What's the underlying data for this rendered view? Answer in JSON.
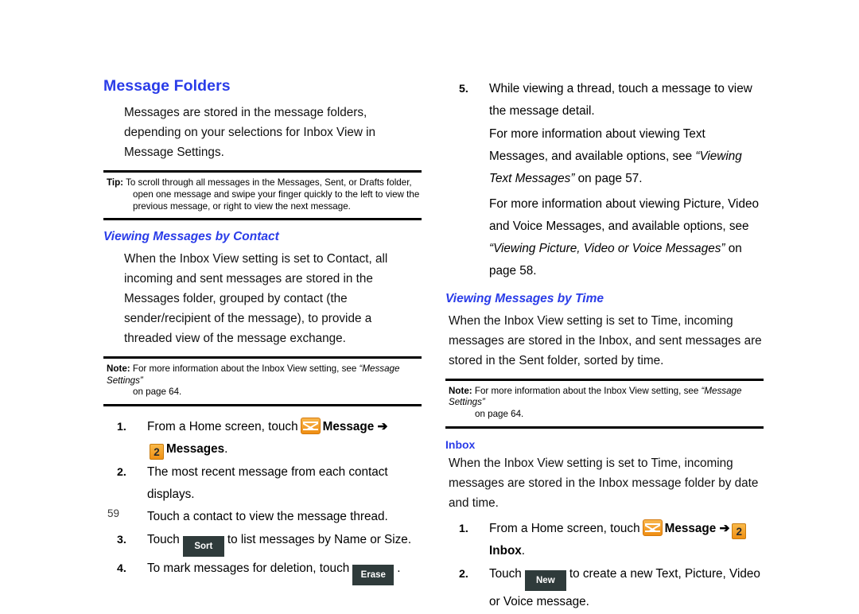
{
  "page": {
    "number": "59"
  },
  "left_column": {
    "heading": "Message Folders",
    "intro": "Messages are stored in the message folders, depending on your selections for Inbox View in Message Settings.",
    "tip": {
      "label": "Tip:",
      "line1": "To scroll through all messages in the Messages, Sent, or Drafts folder,",
      "line2": "open one message and swipe your finger quickly to the left to view the previous message, or right to view the next message."
    },
    "subheading": "Viewing Messages by Contact",
    "body": "When the Inbox View setting is set to Contact, all incoming and sent messages are stored in the Messages folder, grouped by contact (the sender/recipient of the message), to provide a threaded view of the message exchange.",
    "note": {
      "label": "Note:",
      "line1": "For more information about the Inbox View setting, see",
      "ref": "“Message Settings”",
      "line2": "on page 64."
    },
    "steps": [
      {
        "num": "1.",
        "text_before": "From a Home screen, touch",
        "icon": "envelope-icon",
        "link_label": "Message",
        "arrow": "➔",
        "badge": "2",
        "target_label": "Messages",
        "period": "."
      },
      {
        "num": "2.",
        "line1": "The most recent message from each contact displays.",
        "line2": "Touch a contact to view the message thread."
      },
      {
        "num": "3.",
        "text_before": "Touch",
        "button": "Sort",
        "text_after": "to list messages by Name or Size."
      },
      {
        "num": "4.",
        "text_before": "To mark messages for deletion, touch",
        "button": "Erase",
        "text_after": "."
      }
    ]
  },
  "right_column": {
    "step5": {
      "num": "5.",
      "line1": "While viewing a thread, touch a message to view the message detail.",
      "para1_a": "For more information about viewing Text Messages, and available options, see",
      "para1_ref": "“Viewing Text Messages”",
      "para1_b": "on page 57.",
      "para2_a": "For more information about viewing Picture, Video and Voice Messages, and available options, see",
      "para2_ref": "“Viewing Picture, Video or Voice Messages”",
      "para2_b": "on page 58."
    },
    "subheading": "Viewing Messages by Time",
    "body": "When the Inbox View setting is set to Time, incoming messages are stored in the Inbox, and sent messages are stored in the Sent folder, sorted by time.",
    "note": {
      "label": "Note:",
      "line1": "For more information about the Inbox View setting, see",
      "ref": "“Message Settings”",
      "line2": "on page 64."
    },
    "inbox_heading": "Inbox",
    "inbox_body": "When the Inbox View setting is set to Time, incoming  messages are stored in the Inbox message folder by date and time.",
    "steps": [
      {
        "num": "1.",
        "text_before": "From a Home screen, touch",
        "icon": "envelope-icon",
        "link_label": "Message",
        "arrow": "➔",
        "badge": "2",
        "target_label": "Inbox",
        "period": "."
      },
      {
        "num": "2.",
        "text_before": "Touch",
        "button": "New",
        "text_after": "to create a new Text, Picture, Video or Voice message."
      }
    ]
  },
  "colors": {
    "heading_blue": "#2a3ce8",
    "icon_orange": "#f09013",
    "key_dark": "#2f3b3b"
  }
}
